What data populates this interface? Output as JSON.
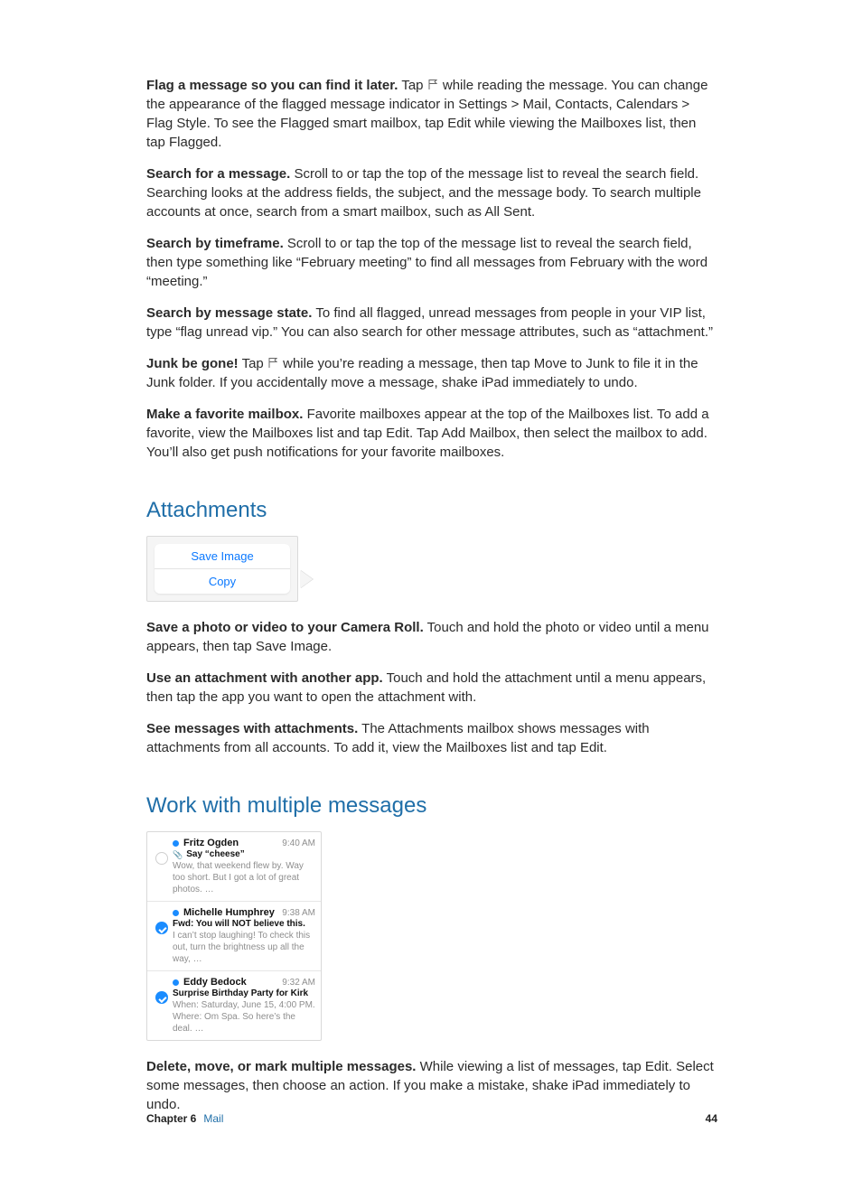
{
  "tips": [
    {
      "bold": "Flag a message so you can find it later.",
      "pre": "Tap ",
      "flag": true,
      "text": " while reading the message. You can change the appearance of the flagged message indicator in Settings > Mail, Contacts, Calendars > Flag Style. To see the Flagged smart mailbox, tap Edit while viewing the Mailboxes list, then tap Flagged."
    },
    {
      "bold": "Search for a message.",
      "text": "Scroll to or tap the top of the message list to reveal the search field. Searching looks at the address fields, the subject, and the message body. To search multiple accounts at once, search from a smart mailbox, such as All Sent."
    },
    {
      "bold": "Search by timeframe.",
      "text": "Scroll to or tap the top of the message list to reveal the search field, then type something like “February meeting” to find all messages from February with the word “meeting.”"
    },
    {
      "bold": "Search by message state.",
      "text": "To find all flagged, unread messages from people in your VIP list, type “flag unread vip.” You can also search for other message attributes, such as “attachment.”"
    },
    {
      "bold": "Junk be gone!",
      "pre": "Tap ",
      "flag": true,
      "text": " while you’re reading a message, then tap Move to Junk to file it in the Junk folder. If you accidentally move a message, shake iPad immediately to undo."
    },
    {
      "bold": "Make a favorite mailbox.",
      "text": "Favorite mailboxes appear at the top of the Mailboxes list. To add a favorite, view the Mailboxes list and tap Edit. Tap Add Mailbox, then select the mailbox to add. You’ll also get push notifications for your favorite mailboxes."
    }
  ],
  "attachments": {
    "heading": "Attachments",
    "popup": {
      "save": "Save Image",
      "copy": "Copy"
    },
    "paras": [
      {
        "bold": "Save a photo or video to your Camera Roll.",
        "text": "Touch and hold the photo or video until a menu appears, then tap Save Image."
      },
      {
        "bold": "Use an attachment with another app.",
        "text": "Touch and hold the attachment until a menu appears, then tap the app you want to open the attachment with."
      },
      {
        "bold": "See messages with attachments.",
        "text": "The Attachments mailbox shows messages with attachments from all accounts. To add it, view the Mailboxes list and tap Edit."
      }
    ]
  },
  "multi": {
    "heading": "Work with multiple messages",
    "messages": [
      {
        "sender": "Fritz Ogden",
        "time": "9:40 AM",
        "subject": "Say “cheese”",
        "attach": true,
        "preview": "Wow, that weekend flew by. Way too short. But I got a lot of great photos. …",
        "selected": false
      },
      {
        "sender": "Michelle Humphrey",
        "time": "9:38 AM",
        "subject": "Fwd: You will NOT believe this.",
        "attach": false,
        "preview": "I can’t stop laughing! To check this out, turn the brightness up all the way, …",
        "selected": true
      },
      {
        "sender": "Eddy Bedock",
        "time": "9:32 AM",
        "subject": "Surprise Birthday Party for Kirk",
        "attach": false,
        "preview": "When: Saturday, June 15, 4:00 PM. Where: Om Spa. So here’s the deal. …",
        "selected": true
      }
    ],
    "para": {
      "bold": "Delete, move, or mark multiple messages.",
      "text": "While viewing a list of messages, tap Edit. Select some messages, then choose an action. If you make a mistake, shake iPad immediately to undo."
    }
  },
  "footer": {
    "chapter": "Chapter  6",
    "title": "Mail",
    "page": "44"
  }
}
